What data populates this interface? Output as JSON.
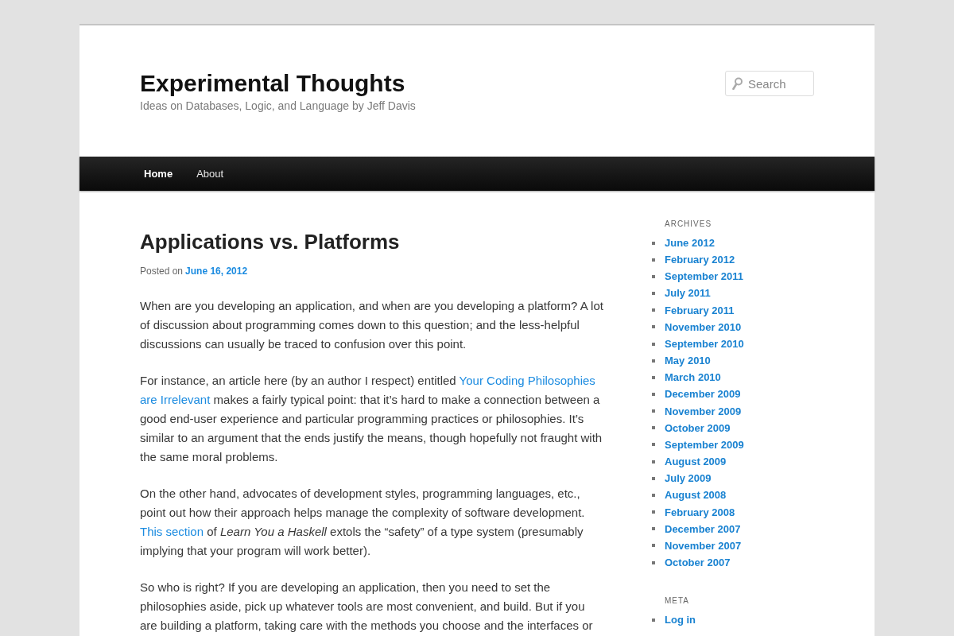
{
  "site": {
    "title": "Experimental Thoughts",
    "tagline": "Ideas on Databases, Logic, and Language by Jeff Davis"
  },
  "search": {
    "placeholder": "Search"
  },
  "nav": {
    "items": [
      {
        "label": "Home",
        "selected": true
      },
      {
        "label": "About",
        "selected": false
      }
    ]
  },
  "post": {
    "title": "Applications vs. Platforms",
    "posted_prefix": "Posted on",
    "date": "June 16, 2012",
    "paragraphs": [
      {
        "segments": [
          {
            "kind": "text",
            "text": "When are you developing an application, and when are you developing a platform? A lot of discussion about programming comes down to this question; and the less-helpful discussions can usually be traced to confusion over this point."
          }
        ]
      },
      {
        "segments": [
          {
            "kind": "text",
            "text": "For instance, an article here (by an author I respect) entitled "
          },
          {
            "kind": "link",
            "text": "Your Coding Philosophies "
          },
          {
            "kind": "link",
            "text": "are Irrelevant"
          },
          {
            "kind": "text",
            "text": " makes a fairly typical point: that it’s hard to make a connection between a good end-user experience and particular programming practices or philosophies. It’s similar to an argument that the ends justify the means, though hopefully not fraught with the same moral problems."
          }
        ]
      },
      {
        "segments": [
          {
            "kind": "text",
            "text": "On the other hand, advocates of development styles, programming languages, etc., point out how their approach helps manage the complexity of software development. "
          },
          {
            "kind": "link",
            "text": "This section"
          },
          {
            "kind": "text",
            "text": " of *Learn You a Haskell* extols the “safety” of a type system (presumably implying that your program will work better)."
          }
        ]
      },
      {
        "segments": [
          {
            "kind": "text",
            "text": "So who is right? If you are developing an application, then you need to set the philosophies aside, pick up whatever tools are most convenient, and build. But if you are building a platform, taking care with the methods you choose and the interfaces or"
          }
        ]
      }
    ]
  },
  "sidebar": {
    "widgets": [
      {
        "title": "ARCHIVES",
        "links": [
          "June 2012",
          "February 2012",
          "September 2011",
          "July 2011",
          "February 2011",
          "November 2010",
          "September 2010",
          "May 2010",
          "March 2010",
          "December 2009",
          "November 2009",
          "October 2009",
          "September 2009",
          "August 2009",
          "July 2009",
          "August 2008",
          "February 2008",
          "December 2007",
          "November 2007",
          "October 2007"
        ]
      },
      {
        "title": "META",
        "links": [
          "Log in"
        ]
      }
    ]
  }
}
